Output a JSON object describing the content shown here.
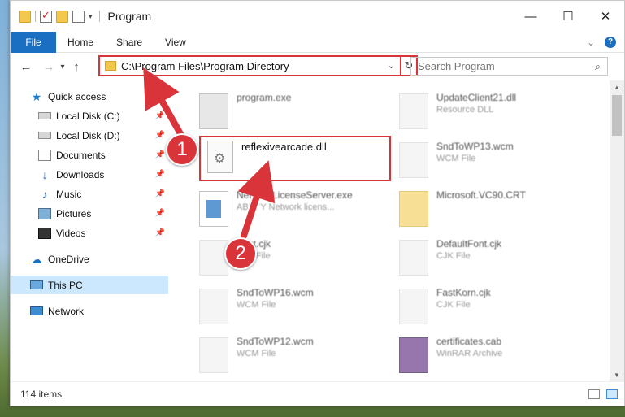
{
  "window": {
    "title": "Program",
    "controls": {
      "minimize": "—",
      "maximize": "☐",
      "close": "✕"
    }
  },
  "ribbon": {
    "tabs": [
      "File",
      "Home",
      "Share",
      "View"
    ],
    "help": "?"
  },
  "nav": {
    "back": "←",
    "forward": "→",
    "recent": "▾",
    "up": "↑",
    "address": "C:\\Program Files\\Program Directory",
    "refresh": "↻",
    "search_placeholder": "Search Program",
    "search_icon": "⌕"
  },
  "sidebar": {
    "items": [
      {
        "label": "Quick access",
        "icon": "star-icon",
        "pinned": false,
        "selected": false
      },
      {
        "label": "Local Disk (C:)",
        "icon": "drive-icon",
        "pinned": true,
        "selected": false
      },
      {
        "label": "Local Disk (D:)",
        "icon": "drive-icon",
        "pinned": true,
        "selected": false
      },
      {
        "label": "Documents",
        "icon": "documents-icon",
        "pinned": true,
        "selected": false
      },
      {
        "label": "Downloads",
        "icon": "download-icon",
        "pinned": true,
        "selected": false
      },
      {
        "label": "Music",
        "icon": "music-icon",
        "pinned": true,
        "selected": false
      },
      {
        "label": "Pictures",
        "icon": "pictures-icon",
        "pinned": true,
        "selected": false
      },
      {
        "label": "Videos",
        "icon": "videos-icon",
        "pinned": true,
        "selected": false
      },
      {
        "label": "OneDrive",
        "icon": "cloud-icon",
        "pinned": false,
        "selected": false
      },
      {
        "label": "This PC",
        "icon": "computer-icon",
        "pinned": false,
        "selected": true
      },
      {
        "label": "Network",
        "icon": "network-icon",
        "pinned": false,
        "selected": false
      }
    ]
  },
  "files": {
    "left": [
      {
        "name": "program.exe",
        "type": ""
      },
      {
        "name": "NetworkLicenseServer.exe",
        "type": "ABBYY Network licens..."
      },
      {
        "name": "Font.cjk",
        "type": "CJK File"
      },
      {
        "name": "SndToWP16.wcm",
        "type": "WCM File"
      },
      {
        "name": "SndToWP12.wcm",
        "type": "WCM File"
      }
    ],
    "right": [
      {
        "name": "UpdateClient21.dll",
        "type": "Resource DLL"
      },
      {
        "name": "SndToWP13.wcm",
        "type": "WCM File"
      },
      {
        "name": "Microsoft.VC90.CRT",
        "type": ""
      },
      {
        "name": "DefaultFont.cjk",
        "type": "CJK File"
      },
      {
        "name": "FastKorn.cjk",
        "type": "CJK File"
      },
      {
        "name": "certificates.cab",
        "type": "WinRAR Archive"
      }
    ],
    "highlighted": {
      "name": "reflexivearcade.dll"
    }
  },
  "status": {
    "item_count": "114 items"
  },
  "annotations": {
    "step1": "1",
    "step2": "2",
    "accent": "#d9343a"
  }
}
